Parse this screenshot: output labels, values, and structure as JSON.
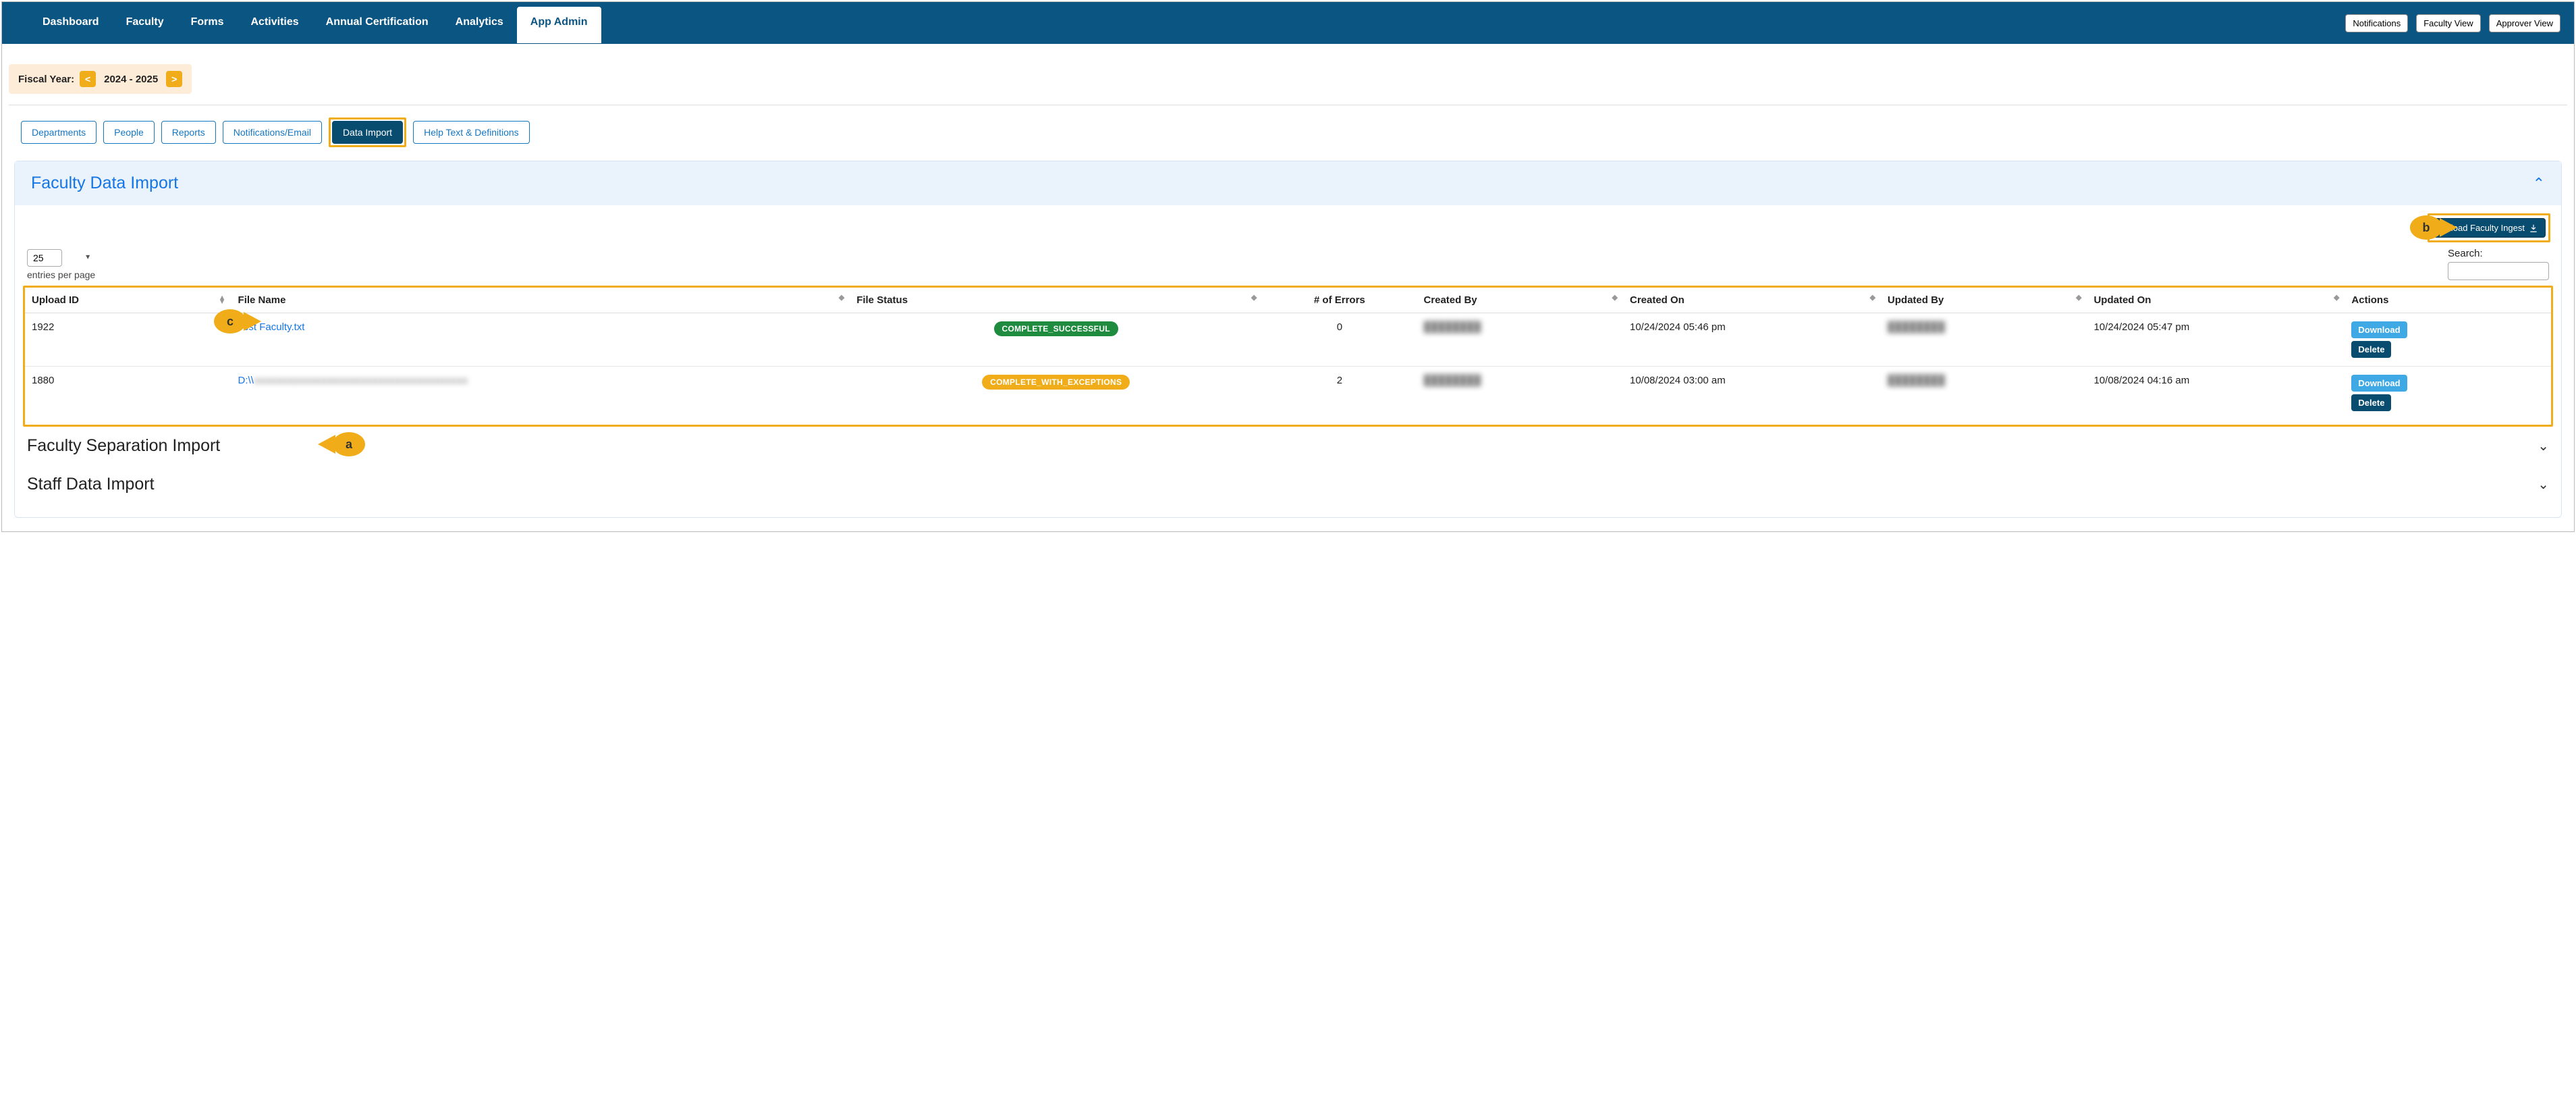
{
  "navbar": {
    "items": [
      {
        "label": "Dashboard"
      },
      {
        "label": "Faculty"
      },
      {
        "label": "Forms"
      },
      {
        "label": "Activities"
      },
      {
        "label": "Annual Certification"
      },
      {
        "label": "Analytics"
      },
      {
        "label": "App Admin",
        "active": true
      }
    ],
    "right_buttons": {
      "notifications": "Notifications",
      "faculty_view": "Faculty View",
      "approver_view": "Approver View"
    }
  },
  "fiscal": {
    "label": "Fiscal Year:",
    "value": "2024 - 2025",
    "prev": "<",
    "next": ">"
  },
  "subtabs": {
    "items": [
      {
        "label": "Departments"
      },
      {
        "label": "People"
      },
      {
        "label": "Reports"
      },
      {
        "label": "Notifications/Email"
      },
      {
        "label": "Data Import",
        "active": true
      },
      {
        "label": "Help Text & Definitions"
      }
    ]
  },
  "panel": {
    "title": "Faculty Data Import",
    "upload_button": "Upload Faculty Ingest",
    "entries_value": "25",
    "entries_label": "entries per page",
    "search_label": "Search:",
    "callouts": {
      "a": "a",
      "b": "b",
      "c": "c"
    }
  },
  "table": {
    "headers": {
      "upload_id": "Upload ID",
      "file_name": "File Name",
      "file_status": "File Status",
      "errors": "# of Errors",
      "created_by": "Created By",
      "created_on": "Created On",
      "updated_by": "Updated By",
      "updated_on": "Updated On",
      "actions": "Actions"
    },
    "rows": [
      {
        "upload_id": "1922",
        "file_name": "Test Faculty.txt",
        "file_status": "COMPLETE_SUCCESSFUL",
        "status_class": "green",
        "errors": "0",
        "created_by": "████████",
        "created_on": "10/24/2024 05:46 pm",
        "updated_by": "████████",
        "updated_on": "10/24/2024 05:47 pm"
      },
      {
        "upload_id": "1880",
        "file_name": "D:\\\\█████████████████████████████",
        "file_status": "COMPLETE_WITH_EXCEPTIONS",
        "status_class": "amber",
        "errors": "2",
        "created_by": "████████",
        "created_on": "10/08/2024 03:00 am",
        "updated_by": "████████",
        "updated_on": "10/08/2024 04:16 am"
      }
    ],
    "buttons": {
      "download": "Download",
      "delete": "Delete"
    }
  },
  "sections": {
    "faculty_separation": "Faculty Separation Import",
    "staff_data": "Staff Data Import"
  }
}
